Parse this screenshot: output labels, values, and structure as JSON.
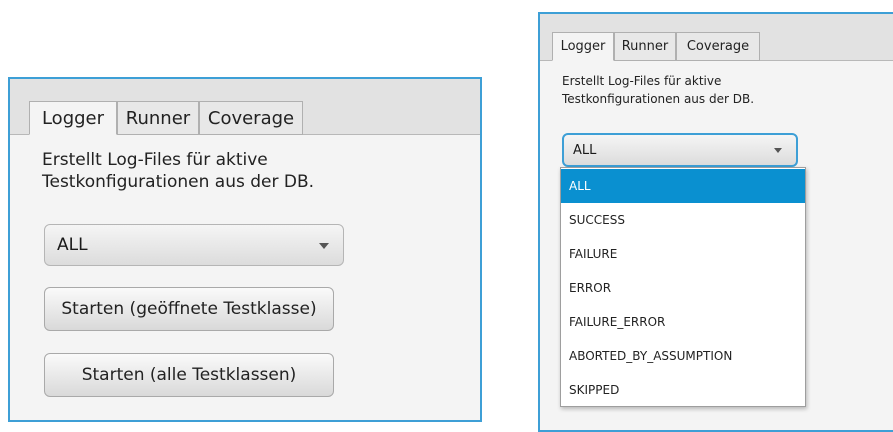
{
  "left": {
    "tabs": [
      "Logger",
      "Runner",
      "Coverage"
    ],
    "description_line1": "Erstellt Log-Files für aktive",
    "description_line2": "Testkonfigurationen aus der DB.",
    "combo_value": "ALL",
    "button_open": "Starten (geöffnete Testklasse)",
    "button_all": "Starten (alle Testklassen)"
  },
  "right": {
    "tabs": [
      "Logger",
      "Runner",
      "Coverage"
    ],
    "description_line1": "Erstellt Log-Files für aktive",
    "description_line2": "Testkonfigurationen aus der DB.",
    "combo_value": "ALL",
    "options": [
      "ALL",
      "SUCCESS",
      "FAILURE",
      "ERROR",
      "FAILURE_ERROR",
      "ABORTED_BY_ASSUMPTION",
      "SKIPPED"
    ],
    "selected_option": "ALL"
  },
  "colors": {
    "focus_border": "#3d9fd6",
    "selection": "#0a90d0"
  }
}
